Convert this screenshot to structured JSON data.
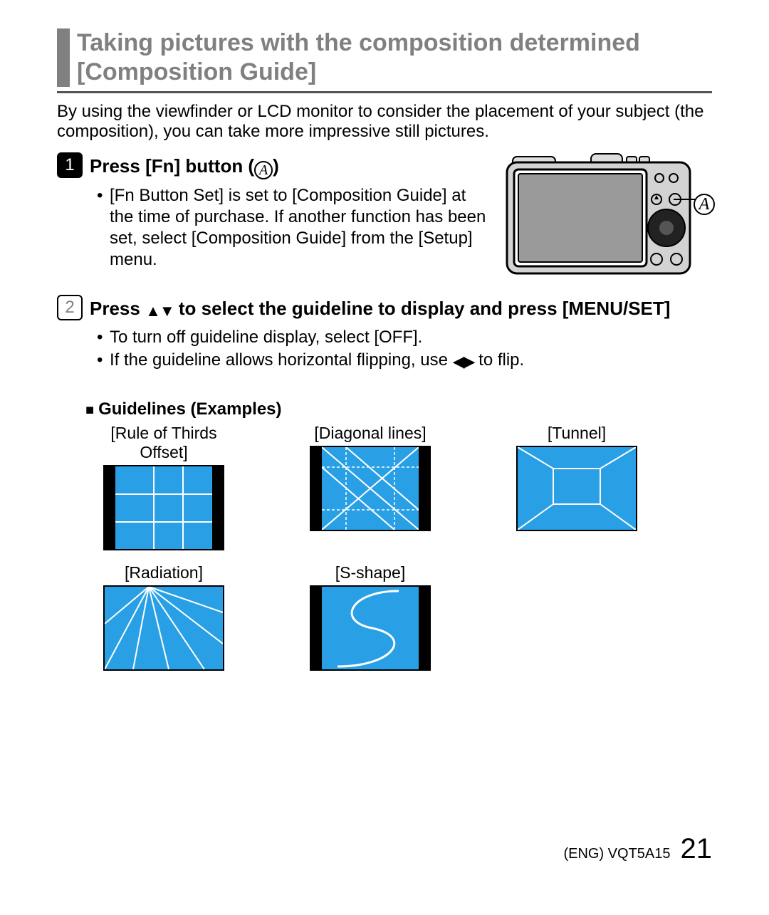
{
  "title": "Taking pictures with the composition determined [Composition Guide]",
  "intro": "By using the viewfinder or LCD monitor to consider the placement of your subject (the composition), you can take more impressive still pictures.",
  "steps": {
    "s1": {
      "num": "1",
      "head_prefix": "Press [Fn] button (",
      "head_suffix": ")",
      "bullet1": "[Fn Button Set] is set to [Composition Guide] at the time of purchase. If another function has been set, select [Composition Guide] from the [Setup] menu."
    },
    "s2": {
      "num": "2",
      "head_prefix": "Press ",
      "head_mid": " to select the guideline to display and press [MENU/SET]",
      "bullet1": "To turn off guideline display, select [OFF].",
      "bullet2_prefix": "If the guideline allows horizontal flipping, use ",
      "bullet2_suffix": " to flip."
    }
  },
  "camera_label_A": "A",
  "section_label": "Guidelines (Examples)",
  "examples": {
    "e1": "[Rule of Thirds Offset]",
    "e2": "[Diagonal lines]",
    "e3": "[Tunnel]",
    "e4": "[Radiation]",
    "e5": "[S-shape]"
  },
  "footer": {
    "code": "(ENG) VQT5A15",
    "page": "21"
  }
}
